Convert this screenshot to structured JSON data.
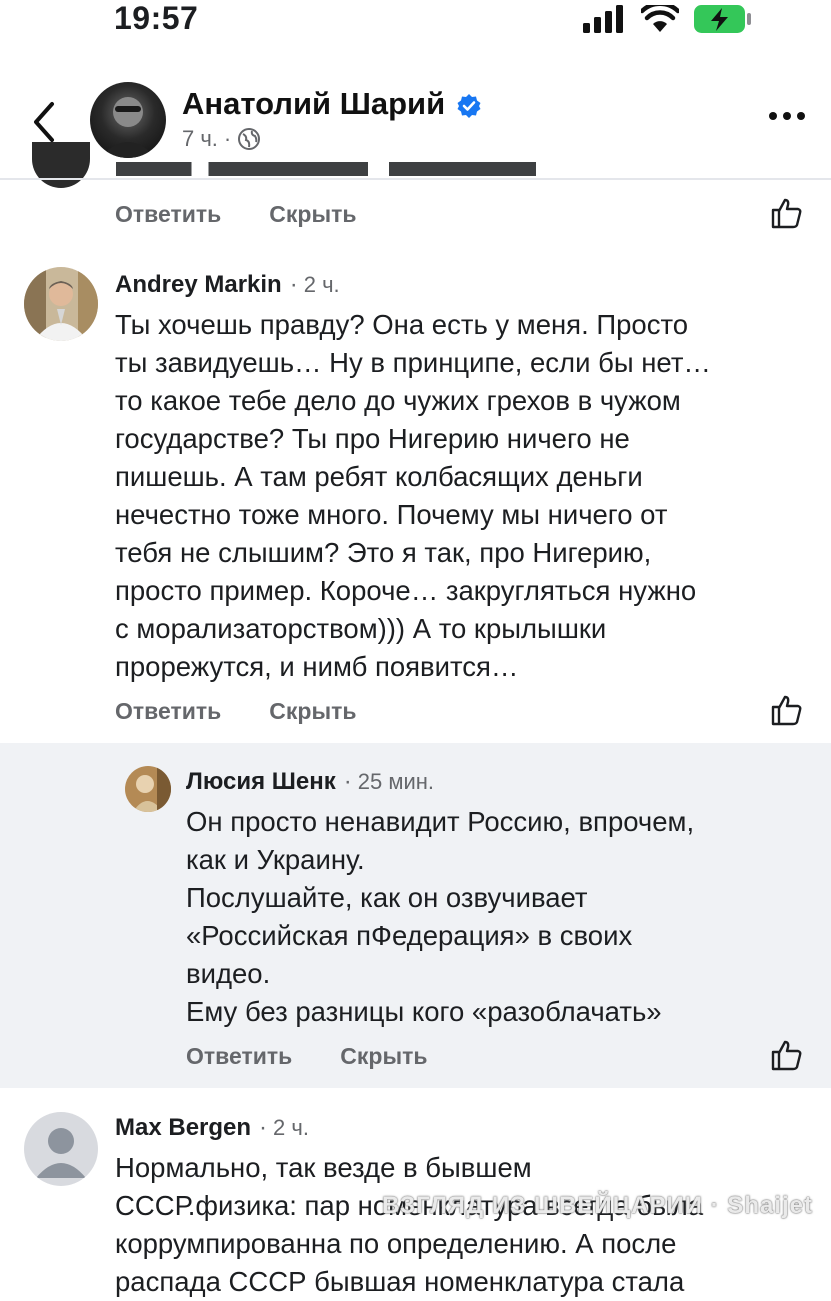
{
  "status_bar": {
    "time": "19:57"
  },
  "post_header": {
    "author": "Анатолий Шарий",
    "time": "7 ч."
  },
  "actions": {
    "reply": "Ответить",
    "hide": "Скрыть"
  },
  "comments": [
    {
      "author": "Andrey Markin",
      "time": "2 ч.",
      "lines": [
        "Ты хочешь правду? Она есть у меня. Просто",
        "ты завидуешь… Ну в принципе, если бы нет…",
        "то какое тебе дело до чужих грехов в чужом",
        "государстве? Ты про Нигерию ничего не",
        "пишешь. А там ребят колбасящих деньги",
        "нечестно тоже много. Почему мы ничего от",
        "тебя не слышим? Это я так, про Нигерию,",
        "просто пример. Короче… закругляться нужно",
        "с морализаторством))) А то крылышки",
        "прорежутся, и нимб появится…"
      ]
    },
    {
      "author": "Люсия Шенк",
      "time": "25 мин.",
      "lines": [
        "Он просто ненавидит Россию, впрочем,",
        "как и Украину.",
        "Послушайте, как он озвучивает",
        "«Российская пФедерация» в своих",
        "видео.",
        "Ему без разницы кого «разоблачать»"
      ]
    },
    {
      "author": "Max Bergen",
      "time": "2 ч.",
      "lines": [
        "Нормально, так везде в бывшем",
        "СССР.физика: пар номенклатура всегда была",
        "коррумпированна по определению. А после",
        "распада СССР бывшая номенклатура стала"
      ]
    }
  ],
  "watermark": "ВЗГЛЯД ИЗ ШВЕЙЦАРИИ · Shaijet",
  "colors": {
    "accent_verified": "#1877f2",
    "muted": "#65676b",
    "reply_bg": "#f0f2f5"
  },
  "icons": [
    "back-chevron-icon",
    "verified-badge-icon",
    "globe-icon",
    "more-dots-icon",
    "like-thumb-icon",
    "default-avatar-icon"
  ]
}
